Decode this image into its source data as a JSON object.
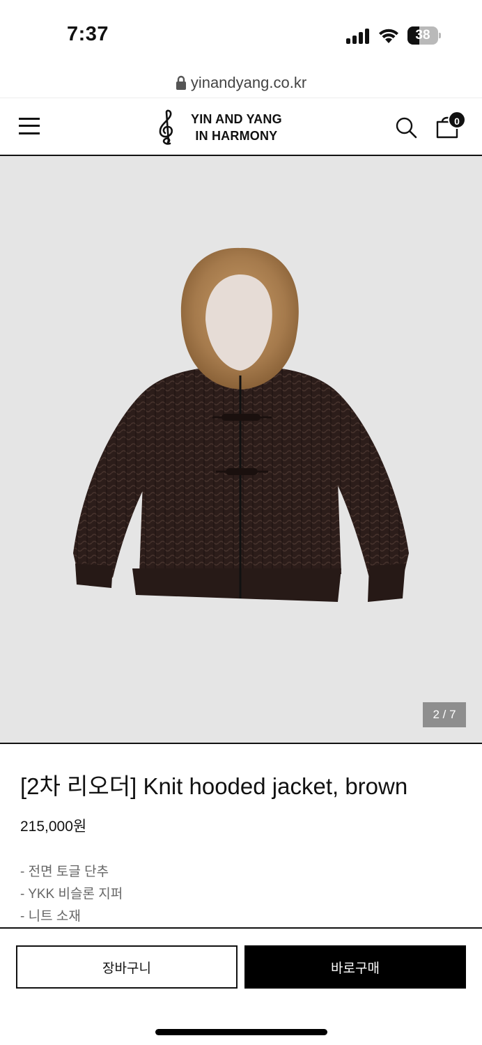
{
  "status_bar": {
    "time": "7:37",
    "battery_level": "38",
    "battery_fraction": 0.38,
    "signal_bars": 4,
    "icons": [
      "signal-icon",
      "wifi-icon",
      "battery-icon"
    ]
  },
  "browser": {
    "url": "yinandyang.co.kr",
    "lock_icon": "lock-icon"
  },
  "header": {
    "menu_icon": "hamburger-menu-icon",
    "logo_line1": "YIN AND YANG",
    "logo_line2": "IN HARMONY",
    "search_icon": "search-icon",
    "cart_icon": "shopping-bag-icon",
    "cart_count": "0"
  },
  "product": {
    "image_counter": "2 / 7",
    "title": "[2차 리오더] Knit hooded jacket, brown",
    "price": "215,000원",
    "features": [
      "- 전면 토글 단추",
      "- YKK 비슬론 지퍼",
      "- 니트 소재"
    ]
  },
  "actions": {
    "add_to_cart": "장바구니",
    "buy_now": "바로구매"
  },
  "colors": {
    "accent": "#000000",
    "image_background": "#e5e5e5",
    "jacket_body": "#2e1f1c",
    "fur_trim": "#a77c4d"
  }
}
